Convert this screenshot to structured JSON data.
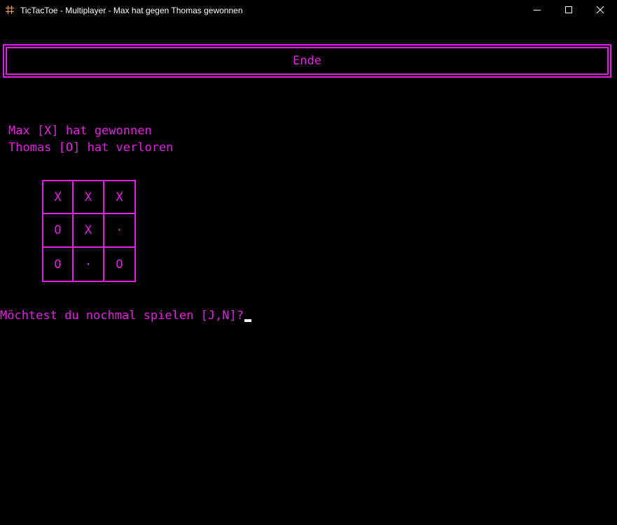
{
  "window": {
    "title": "TicTacToe - Multiplayer - Max hat gegen Thomas gewonnen",
    "icon": "hash-grid-icon",
    "controls": [
      "minimize-icon",
      "maximize-icon",
      "close-icon"
    ]
  },
  "header": {
    "label": "Ende"
  },
  "result": {
    "winner_line": "Max [X] hat gewonnen",
    "loser_line": "Thomas [O] hat verloren"
  },
  "board": {
    "rows": [
      [
        "X",
        "X",
        "X"
      ],
      [
        "O",
        "X",
        "·"
      ],
      [
        "O",
        "·",
        "O"
      ]
    ]
  },
  "prompt": {
    "text": "Möchtest du nochmal spielen [J,N]?"
  },
  "colors": {
    "background": "#000000",
    "accent": "#e020e0",
    "title_text": "#ffffff",
    "cursor": "#ffffff"
  }
}
